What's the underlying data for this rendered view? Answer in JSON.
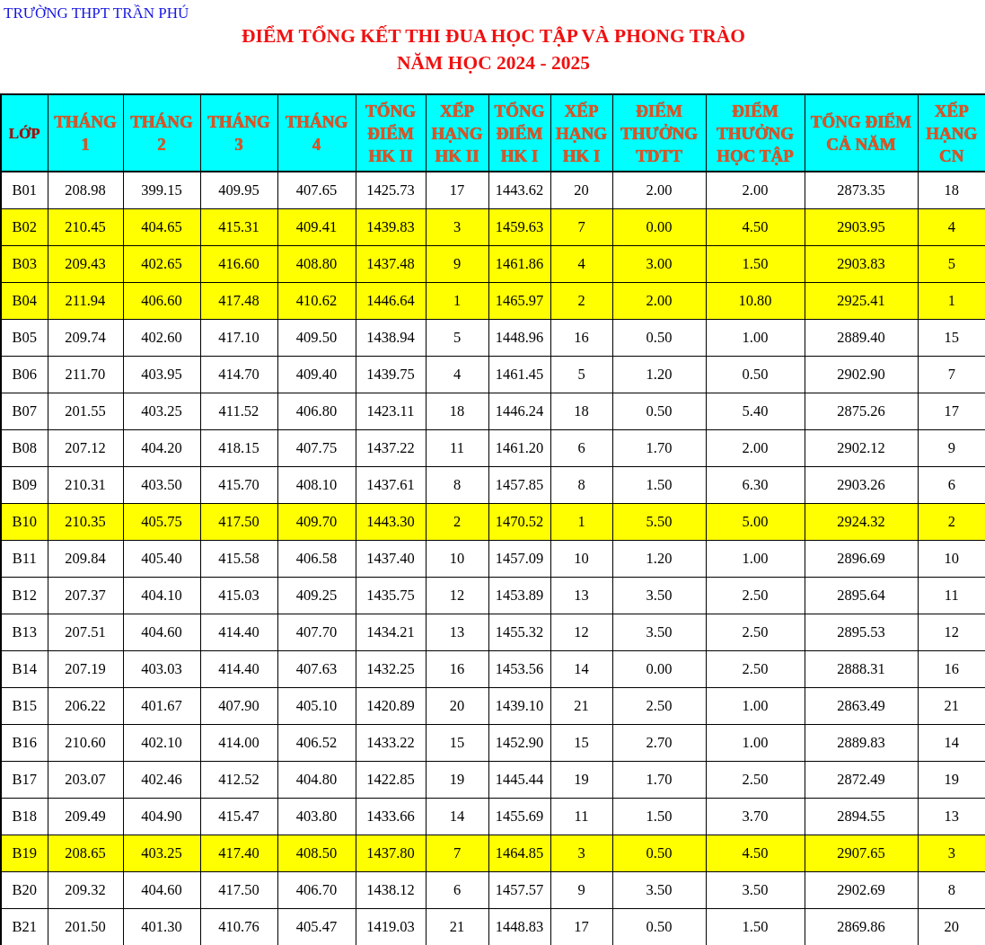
{
  "school": "TRƯỜNG THPT TRẦN PHÚ",
  "title": [
    "ĐIỂM TỔNG KẾT THI ĐUA HỌC TẬP VÀ PHONG TRÀO",
    "NĂM HỌC 2024 - 2025"
  ],
  "table": {
    "columns": [
      "LỚP",
      "THÁNG\n1",
      "THÁNG\n2",
      "THÁNG\n3",
      "THÁNG\n4",
      "TỔNG\nĐIỂM\nHK II",
      "XẾP\nHẠNG\nHK II",
      "TỔNG\nĐIỂM\nHK I",
      "XẾP\nHẠNG\nHK I",
      "ĐIỂM\nTHƯỞNG\nTDTT",
      "ĐIỂM\nTHƯỞNG\nHỌC TẬP",
      "TỔNG ĐIỂM\nCẢ NĂM",
      "XẾP\nHẠNG\nCN"
    ],
    "rows": [
      {
        "highlighted": false,
        "cells": [
          "B01",
          "208.98",
          "399.15",
          "409.95",
          "407.65",
          "1425.73",
          "17",
          "1443.62",
          "20",
          "2.00",
          "2.00",
          "2873.35",
          "18"
        ]
      },
      {
        "highlighted": true,
        "cells": [
          "B02",
          "210.45",
          "404.65",
          "415.31",
          "409.41",
          "1439.83",
          "3",
          "1459.63",
          "7",
          "0.00",
          "4.50",
          "2903.95",
          "4"
        ]
      },
      {
        "highlighted": true,
        "cells": [
          "B03",
          "209.43",
          "402.65",
          "416.60",
          "408.80",
          "1437.48",
          "9",
          "1461.86",
          "4",
          "3.00",
          "1.50",
          "2903.83",
          "5"
        ]
      },
      {
        "highlighted": true,
        "cells": [
          "B04",
          "211.94",
          "406.60",
          "417.48",
          "410.62",
          "1446.64",
          "1",
          "1465.97",
          "2",
          "2.00",
          "10.80",
          "2925.41",
          "1"
        ]
      },
      {
        "highlighted": false,
        "cells": [
          "B05",
          "209.74",
          "402.60",
          "417.10",
          "409.50",
          "1438.94",
          "5",
          "1448.96",
          "16",
          "0.50",
          "1.00",
          "2889.40",
          "15"
        ]
      },
      {
        "highlighted": false,
        "cells": [
          "B06",
          "211.70",
          "403.95",
          "414.70",
          "409.40",
          "1439.75",
          "4",
          "1461.45",
          "5",
          "1.20",
          "0.50",
          "2902.90",
          "7"
        ]
      },
      {
        "highlighted": false,
        "cells": [
          "B07",
          "201.55",
          "403.25",
          "411.52",
          "406.80",
          "1423.11",
          "18",
          "1446.24",
          "18",
          "0.50",
          "5.40",
          "2875.26",
          "17"
        ]
      },
      {
        "highlighted": false,
        "cells": [
          "B08",
          "207.12",
          "404.20",
          "418.15",
          "407.75",
          "1437.22",
          "11",
          "1461.20",
          "6",
          "1.70",
          "2.00",
          "2902.12",
          "9"
        ]
      },
      {
        "highlighted": false,
        "cells": [
          "B09",
          "210.31",
          "403.50",
          "415.70",
          "408.10",
          "1437.61",
          "8",
          "1457.85",
          "8",
          "1.50",
          "6.30",
          "2903.26",
          "6"
        ]
      },
      {
        "highlighted": true,
        "cells": [
          "B10",
          "210.35",
          "405.75",
          "417.50",
          "409.70",
          "1443.30",
          "2",
          "1470.52",
          "1",
          "5.50",
          "5.00",
          "2924.32",
          "2"
        ]
      },
      {
        "highlighted": false,
        "cells": [
          "B11",
          "209.84",
          "405.40",
          "415.58",
          "406.58",
          "1437.40",
          "10",
          "1457.09",
          "10",
          "1.20",
          "1.00",
          "2896.69",
          "10"
        ]
      },
      {
        "highlighted": false,
        "cells": [
          "B12",
          "207.37",
          "404.10",
          "415.03",
          "409.25",
          "1435.75",
          "12",
          "1453.89",
          "13",
          "3.50",
          "2.50",
          "2895.64",
          "11"
        ]
      },
      {
        "highlighted": false,
        "cells": [
          "B13",
          "207.51",
          "404.60",
          "414.40",
          "407.70",
          "1434.21",
          "13",
          "1455.32",
          "12",
          "3.50",
          "2.50",
          "2895.53",
          "12"
        ]
      },
      {
        "highlighted": false,
        "cells": [
          "B14",
          "207.19",
          "403.03",
          "414.40",
          "407.63",
          "1432.25",
          "16",
          "1453.56",
          "14",
          "0.00",
          "2.50",
          "2888.31",
          "16"
        ]
      },
      {
        "highlighted": false,
        "cells": [
          "B15",
          "206.22",
          "401.67",
          "407.90",
          "405.10",
          "1420.89",
          "20",
          "1439.10",
          "21",
          "2.50",
          "1.00",
          "2863.49",
          "21"
        ]
      },
      {
        "highlighted": false,
        "cells": [
          "B16",
          "210.60",
          "402.10",
          "414.00",
          "406.52",
          "1433.22",
          "15",
          "1452.90",
          "15",
          "2.70",
          "1.00",
          "2889.83",
          "14"
        ]
      },
      {
        "highlighted": false,
        "cells": [
          "B17",
          "203.07",
          "402.46",
          "412.52",
          "404.80",
          "1422.85",
          "19",
          "1445.44",
          "19",
          "1.70",
          "2.50",
          "2872.49",
          "19"
        ]
      },
      {
        "highlighted": false,
        "cells": [
          "B18",
          "209.49",
          "404.90",
          "415.47",
          "403.80",
          "1433.66",
          "14",
          "1455.69",
          "11",
          "1.50",
          "3.70",
          "2894.55",
          "13"
        ]
      },
      {
        "highlighted": true,
        "cells": [
          "B19",
          "208.65",
          "403.25",
          "417.40",
          "408.50",
          "1437.80",
          "7",
          "1464.85",
          "3",
          "0.50",
          "4.50",
          "2907.65",
          "3"
        ]
      },
      {
        "highlighted": false,
        "cells": [
          "B20",
          "209.32",
          "404.60",
          "417.50",
          "406.70",
          "1438.12",
          "6",
          "1457.57",
          "9",
          "3.50",
          "3.50",
          "2902.69",
          "8"
        ]
      },
      {
        "highlighted": false,
        "cells": [
          "B21",
          "201.50",
          "401.30",
          "410.76",
          "405.47",
          "1419.03",
          "21",
          "1448.83",
          "17",
          "0.50",
          "1.50",
          "2869.86",
          "20"
        ]
      }
    ]
  }
}
